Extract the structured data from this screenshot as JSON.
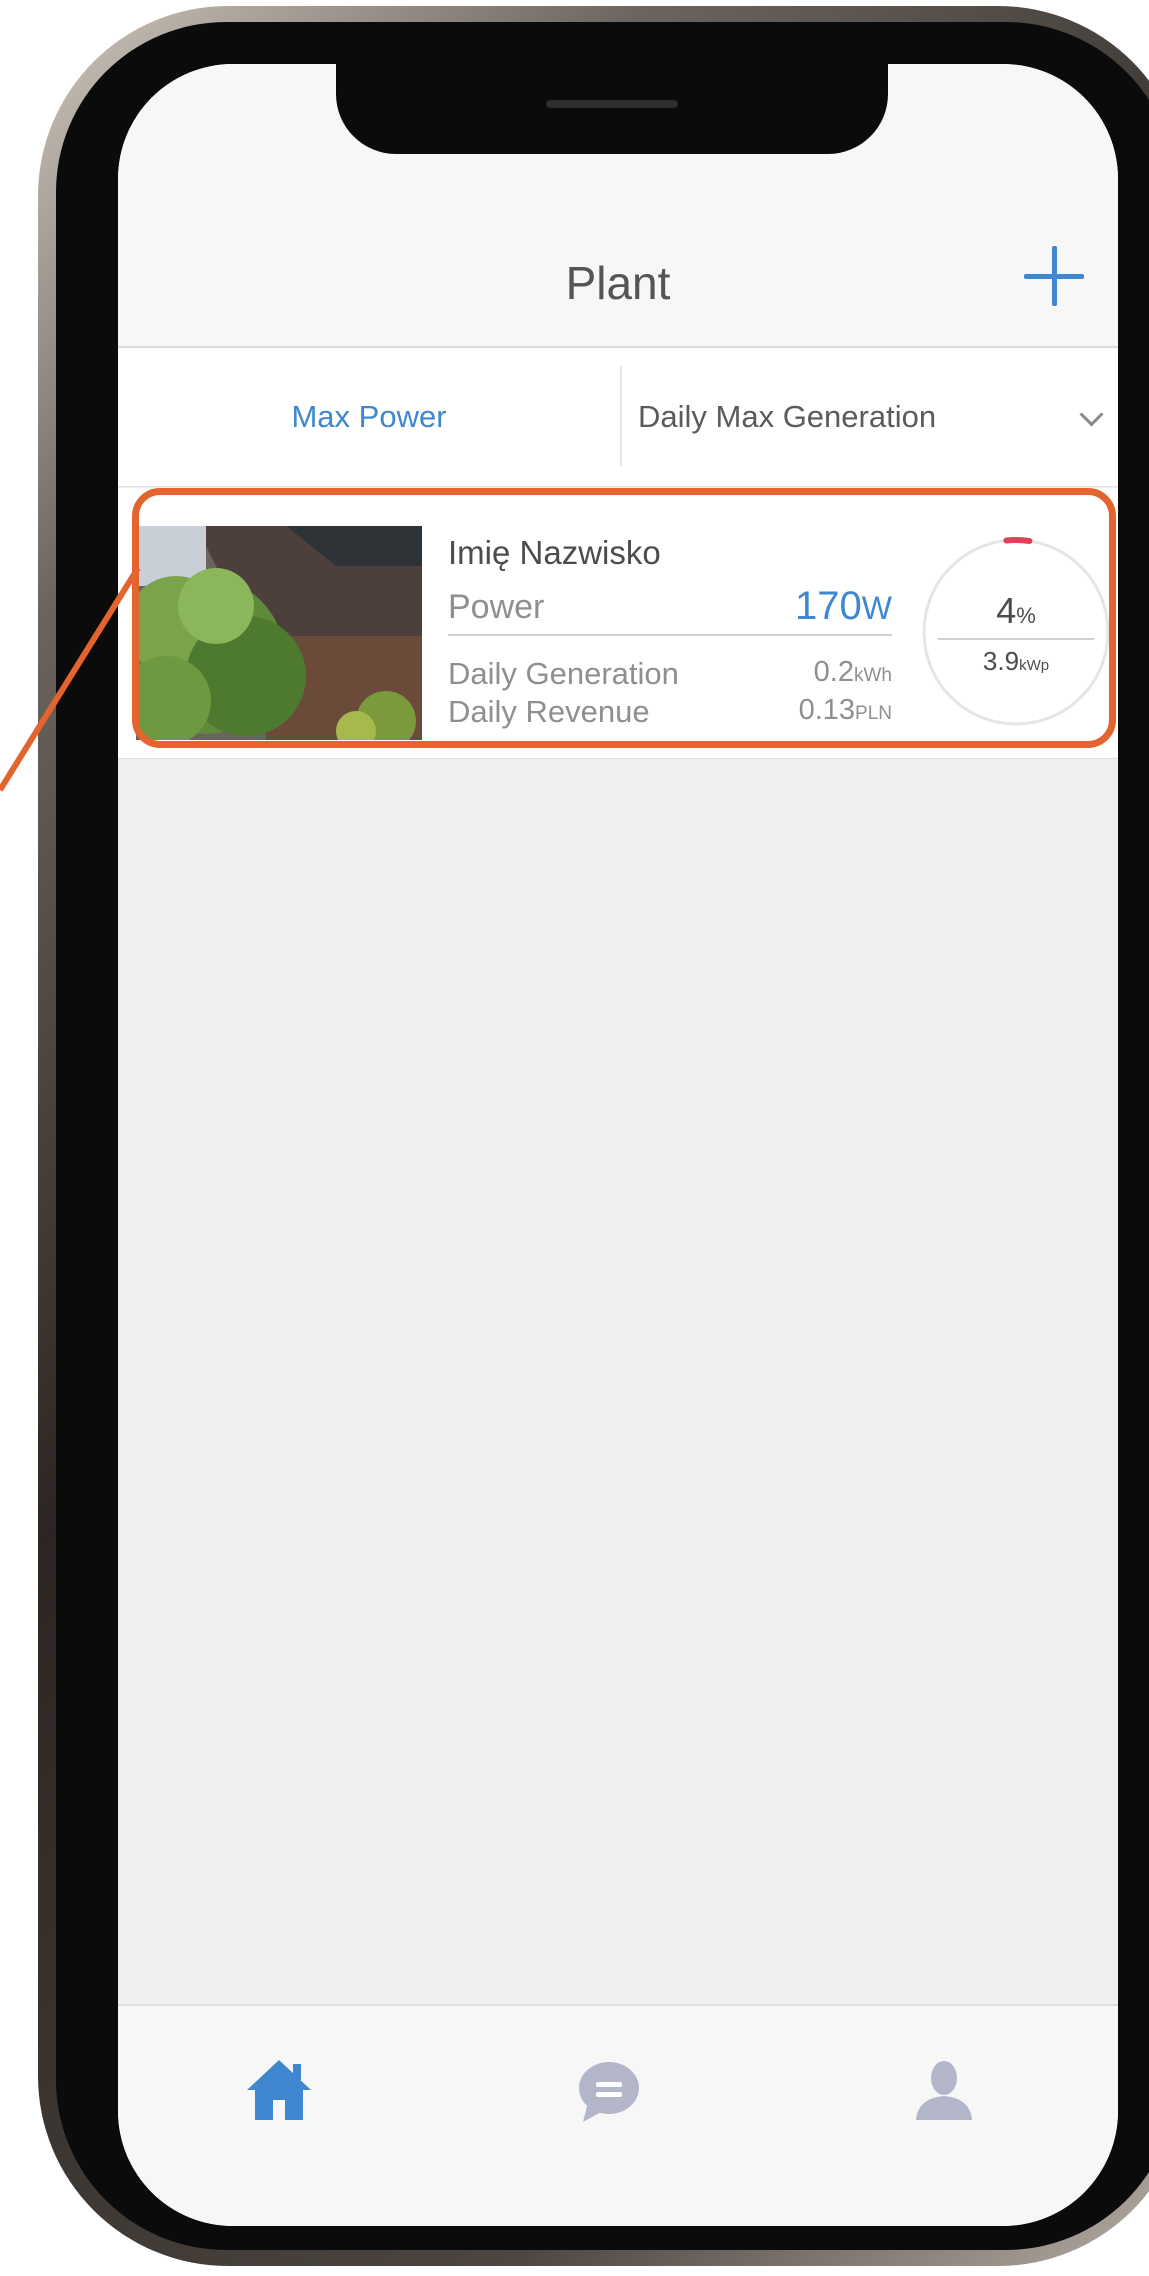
{
  "nav": {
    "title": "Plant"
  },
  "sort": {
    "active_label": "Max Power",
    "secondary_label": "Daily Max Generation"
  },
  "plant": {
    "name": "Imię Nazwisko",
    "power_label": "Power",
    "power_value": "170",
    "power_unit": "W",
    "daily_generation_label": "Daily Generation",
    "daily_generation_value": "0.2",
    "daily_generation_unit": "kWh",
    "daily_revenue_label": "Daily Revenue",
    "daily_revenue_value": "0.13",
    "daily_revenue_unit": "PLN",
    "gauge_percent": "4",
    "gauge_percent_unit": "%",
    "capacity_value": "3.9",
    "capacity_unit": "kWp"
  },
  "tabs": [
    {
      "icon": "home-icon",
      "active": true
    },
    {
      "icon": "message-icon",
      "active": false
    },
    {
      "icon": "profile-icon",
      "active": false
    }
  ],
  "colors": {
    "accent": "#3f87cf",
    "highlight": "#e3642f",
    "gauge_progress": "#e0405a",
    "inactive_icon": "#b3b6c9"
  }
}
